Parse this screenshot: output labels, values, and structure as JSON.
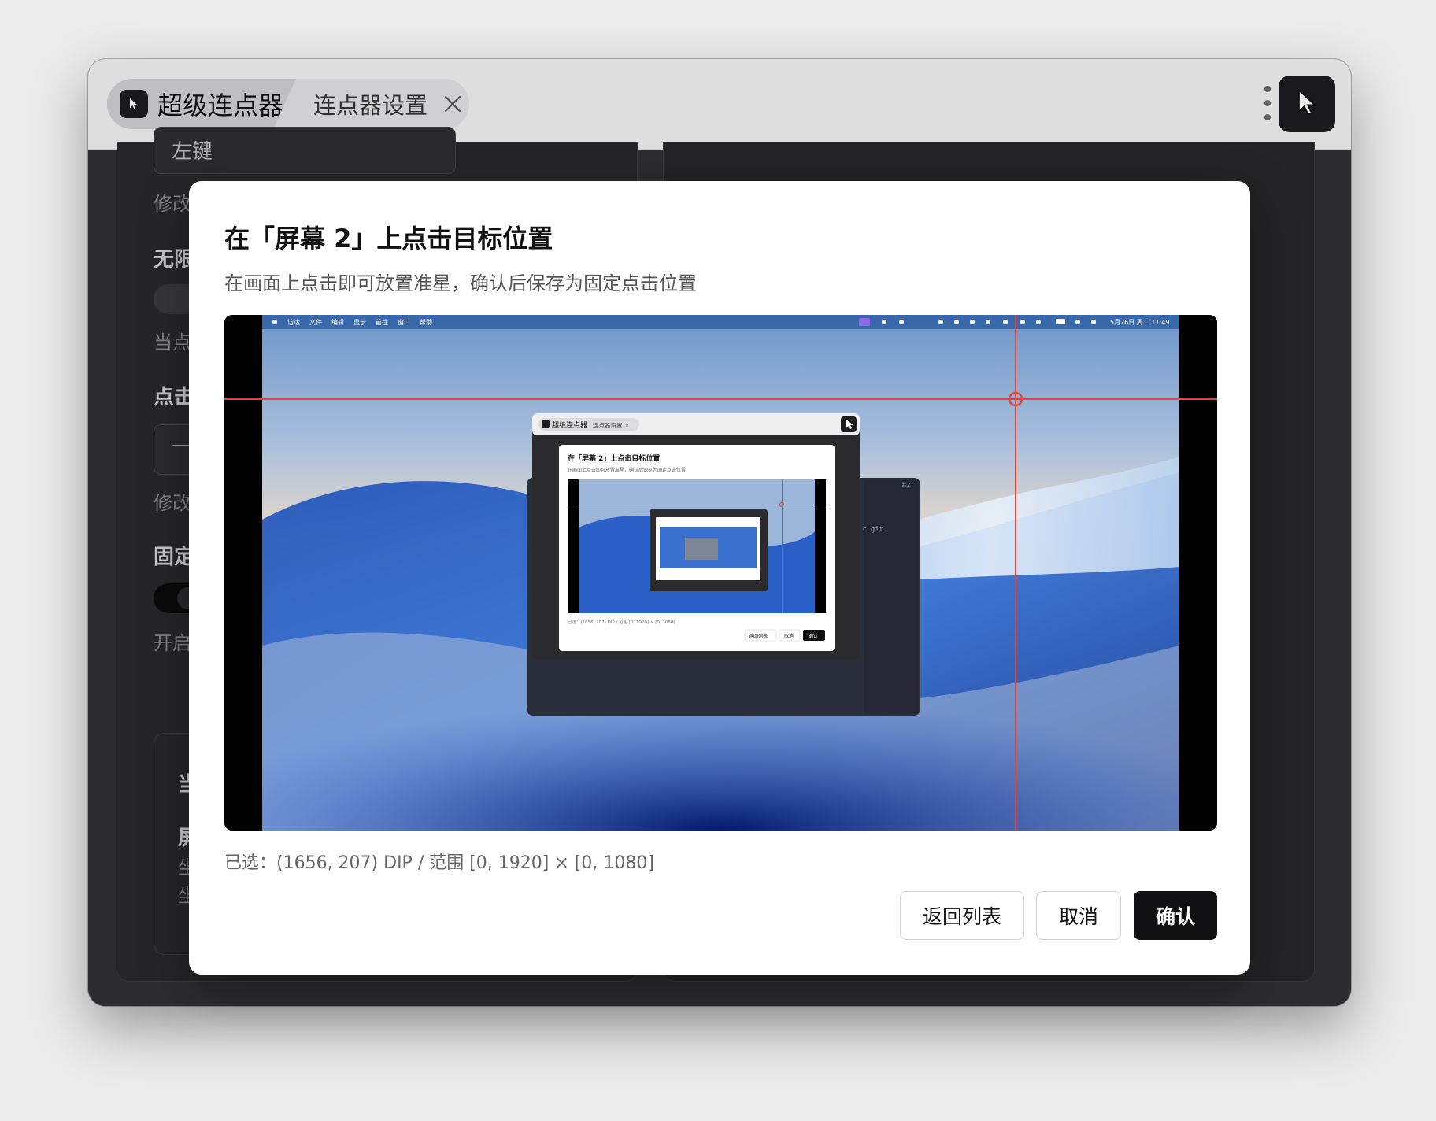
{
  "window": {
    "app_tab_label": "超级连点器",
    "settings_tab_label": "连点器设置",
    "app_icon": "cursor-arrow-icon",
    "close_icon": "close-icon",
    "more_icon": "more-vertical-icon",
    "pointer_icon": "cursor-arrow-icon"
  },
  "background": {
    "select_value": "左键",
    "hint_modify_1": "修改",
    "section_infinite": "无限",
    "hint_current": "当点",
    "section_click": "点击",
    "input_value": "—",
    "hint_modify_2": "修改",
    "section_fixed": "固定",
    "fixed_toggle_on": true,
    "hint_enable": "开启后",
    "card_title": "当",
    "card_screen": "屏",
    "card_coord_1": "坐",
    "card_coord_2": "坐"
  },
  "modal": {
    "title": "在「屏幕 2」上点击目标位置",
    "subtitle": "在画面上点击即可放置准星，确认后保存为固定点击位置",
    "status": "已选：(1656, 207) DIP / 范围 [0, 1920] × [0, 1080]",
    "buttons": {
      "back": "返回列表",
      "cancel": "取消",
      "confirm": "确认"
    }
  },
  "preview": {
    "menubar_items": [
      "访达",
      "文件",
      "编辑",
      "显示",
      "前往",
      "窗口",
      "帮助"
    ],
    "menubar_clock": "5月26日 周二 11:49",
    "crosshair_color": "#e0453a",
    "nested_app_tab": "超级连点器",
    "nested_settings_tab": "连点器设置",
    "nested_title": "在「屏幕 2」上点击目标位置",
    "nested_subtitle": "在画面上点击即可放置准星，确认后保存为固定点击位置",
    "nested_status": "已选：(1656, 207) DIP / 范围 [0, 1920] × [0, 1080]",
    "nested_back": "返回列表",
    "nested_cancel": "取消",
    "nested_confirm": "确认",
    "terminal_text": "r.git",
    "terminal_tab": "⌘2"
  }
}
